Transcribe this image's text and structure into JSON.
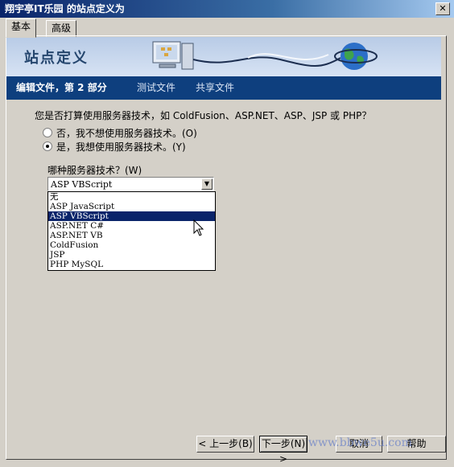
{
  "window": {
    "title": "翔宇亭IT乐园 的站点定义为",
    "close_glyph": "✕"
  },
  "tabs": [
    {
      "label": "基本",
      "active": true
    },
    {
      "label": "高级",
      "active": false
    }
  ],
  "banner": {
    "title": "站点定义"
  },
  "steps": {
    "current": "编辑文件，第 2 部分",
    "test": "测试文件",
    "share": "共享文件"
  },
  "question": "您是否打算使用服务器技术，如 ColdFusion、ASP.NET、ASP、JSP 或 PHP？",
  "radios": [
    {
      "label": "否，我不想使用服务器技术。(O)",
      "checked": false
    },
    {
      "label": "是，我想使用服务器技术。(Y)",
      "checked": true
    }
  ],
  "which_label": "哪种服务器技术？(W)",
  "server_select": {
    "value": "ASP VBScript",
    "options": [
      "无",
      "ASP JavaScript",
      "ASP VBScript",
      "ASP.NET C#",
      "ASP.NET VB",
      "ColdFusion",
      "JSP",
      "PHP MySQL"
    ],
    "highlighted_index": 2
  },
  "buttons": {
    "back": "< 上一步(B)",
    "next": "下一步(N) >",
    "cancel": "取消",
    "help": "帮助"
  },
  "watermark": "www.bbwe5u.com",
  "colors": {
    "nav_bg": "#0e3f7e",
    "selection": "#0a246a",
    "banner_title": "#25466e"
  }
}
